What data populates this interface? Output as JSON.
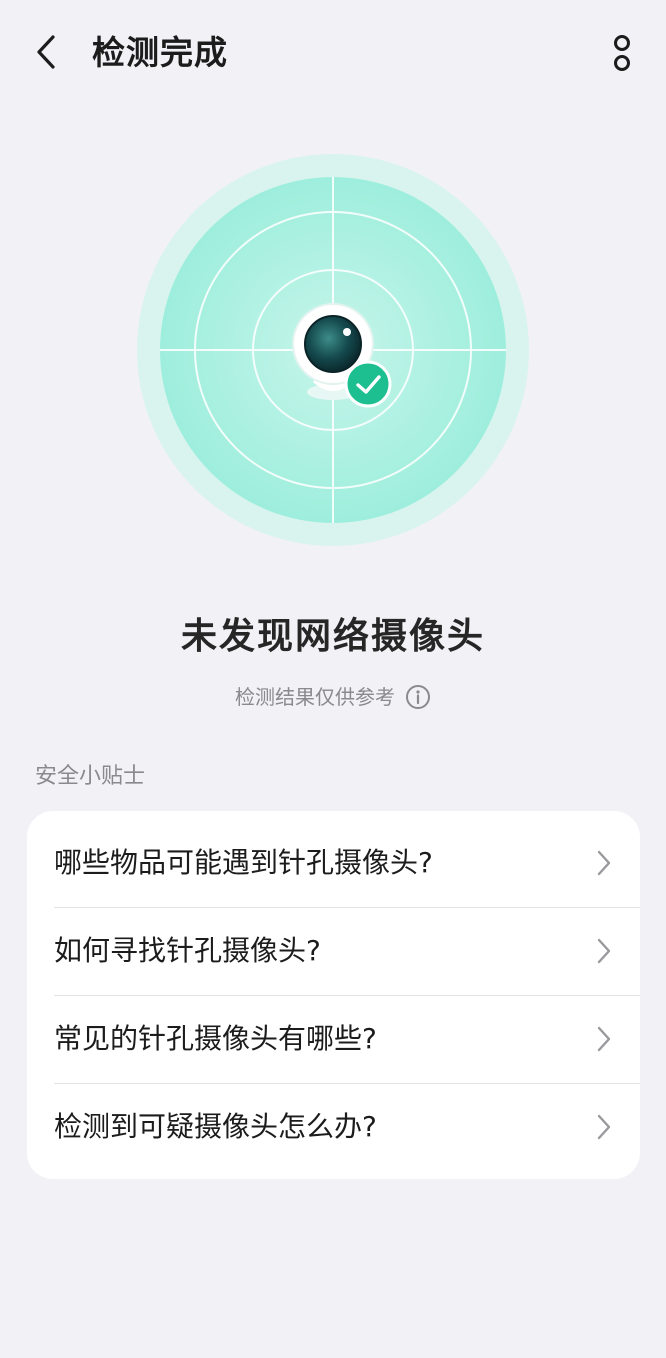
{
  "header": {
    "title": "检测完成",
    "back_icon": "chevron-left-icon",
    "more_icon": "more-vertical-icon"
  },
  "hero": {
    "icon": "camera-check-icon",
    "colors": {
      "outer_ring": "#d9f4ee",
      "inner_disc": "#8ae6d3",
      "accent": "#1dbf91"
    }
  },
  "result": {
    "title": "未发现网络摄像头",
    "subtitle": "检测结果仅供参考",
    "info_icon": "info-icon"
  },
  "tips": {
    "section_title": "安全小贴士",
    "items": [
      {
        "label": "哪些物品可能遇到针孔摄像头?"
      },
      {
        "label": "如何寻找针孔摄像头?"
      },
      {
        "label": "常见的针孔摄像头有哪些?"
      },
      {
        "label": "检测到可疑摄像头怎么办?"
      }
    ]
  }
}
